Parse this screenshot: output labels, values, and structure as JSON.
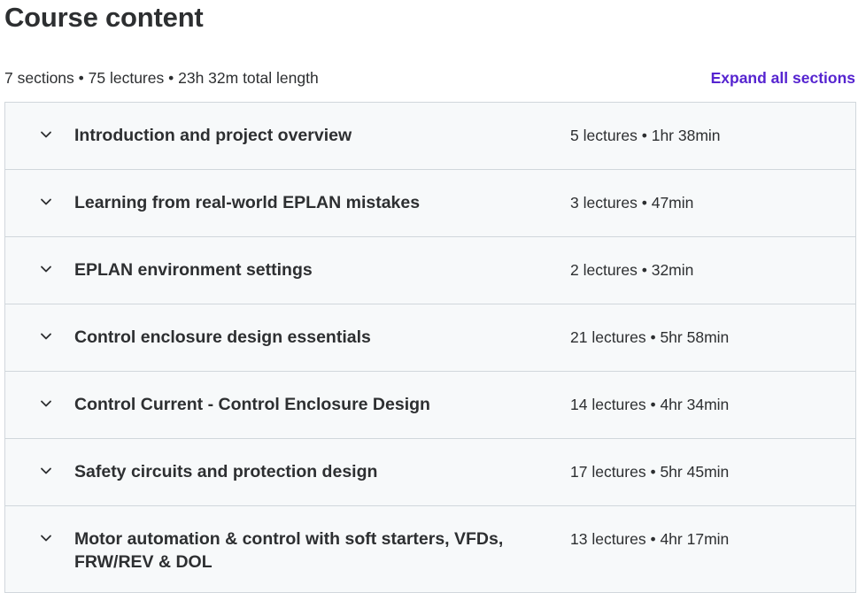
{
  "header": {
    "title": "Course content",
    "summary": "7 sections • 75 lectures • 23h 32m total length",
    "expand_all_label": "Expand all sections"
  },
  "colors": {
    "accent": "#5624d0",
    "text": "#2d2f31",
    "section_bg": "#f7f9fa",
    "border": "#d1d7dc"
  },
  "sections": [
    {
      "title": "Introduction and project overview",
      "meta": "5 lectures • 1hr 38min",
      "icon": "chevron-down-icon"
    },
    {
      "title": "Learning from real-world EPLAN mistakes",
      "meta": "3 lectures • 47min",
      "icon": "chevron-down-icon"
    },
    {
      "title": "EPLAN environment settings",
      "meta": "2 lectures • 32min",
      "icon": "chevron-down-icon"
    },
    {
      "title": "Control enclosure design essentials",
      "meta": "21 lectures • 5hr 58min",
      "icon": "chevron-down-icon"
    },
    {
      "title": "Control Current - Control Enclosure Design",
      "meta": "14 lectures • 4hr 34min",
      "icon": "chevron-down-icon"
    },
    {
      "title": "Safety circuits and protection design",
      "meta": "17 lectures • 5hr 45min",
      "icon": "chevron-down-icon"
    },
    {
      "title": "Motor automation & control with soft starters, VFDs, FRW/REV & DOL",
      "meta": "13 lectures • 4hr 17min",
      "icon": "chevron-down-icon"
    }
  ]
}
